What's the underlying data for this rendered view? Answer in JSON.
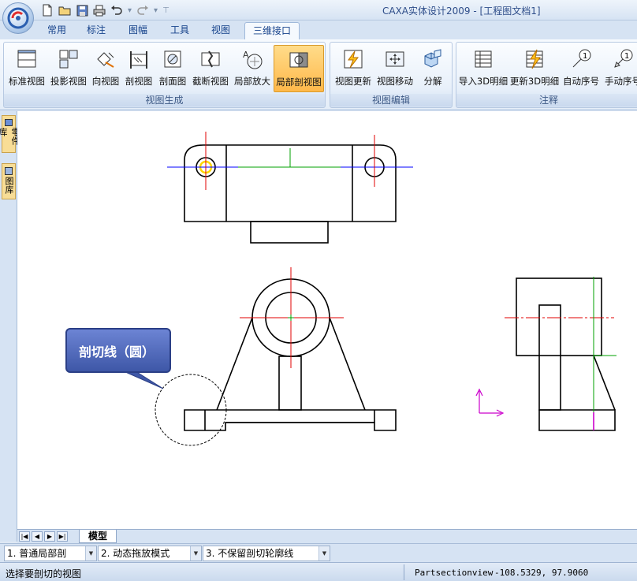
{
  "window": {
    "title": "CAXA实体设计2009 - [工程图文档1]"
  },
  "quick_access": {
    "icons": [
      "new-file-icon",
      "open-folder-icon",
      "save-icon",
      "print-icon",
      "undo-icon",
      "redo-icon"
    ]
  },
  "ribbon": {
    "tabs": [
      "常用",
      "标注",
      "图幅",
      "工具",
      "视图",
      "三维接口"
    ],
    "active_tab": "三维接口",
    "groups": [
      {
        "label": "视图生成",
        "buttons": [
          "标准视图",
          "投影视图",
          "向视图",
          "剖视图",
          "剖面图",
          "截断视图",
          "局部放大",
          "局部剖视图"
        ]
      },
      {
        "label": "视图编辑",
        "buttons": [
          "视图更新",
          "视图移动",
          "分解"
        ]
      },
      {
        "label": "注释",
        "buttons": [
          "导入3D明细",
          "更新3D明细",
          "自动序号",
          "手动序号"
        ]
      }
    ],
    "active_button": "局部剖视图"
  },
  "side_panel": {
    "tabs": [
      "零件库",
      "图库"
    ]
  },
  "canvas": {
    "callout_text": "剖切线（圆）",
    "axis_color": "#cc00cc",
    "centerline_color": "#e00000",
    "ref_line_color": "#00a000",
    "axis_line_color": "#0000ff",
    "highlight_color": "#ffd700"
  },
  "sheet_tabs": {
    "active": "模型"
  },
  "property_bar": {
    "options": [
      {
        "index": "1.",
        "value": "普通局部剖"
      },
      {
        "index": "2.",
        "value": "动态拖放模式"
      },
      {
        "index": "3.",
        "value": "不保留剖切轮廓线"
      }
    ]
  },
  "status_bar": {
    "prompt": "选择要剖切的视图",
    "command": "Partsectionview",
    "coordinates": "-108.5329, 97.9060"
  }
}
